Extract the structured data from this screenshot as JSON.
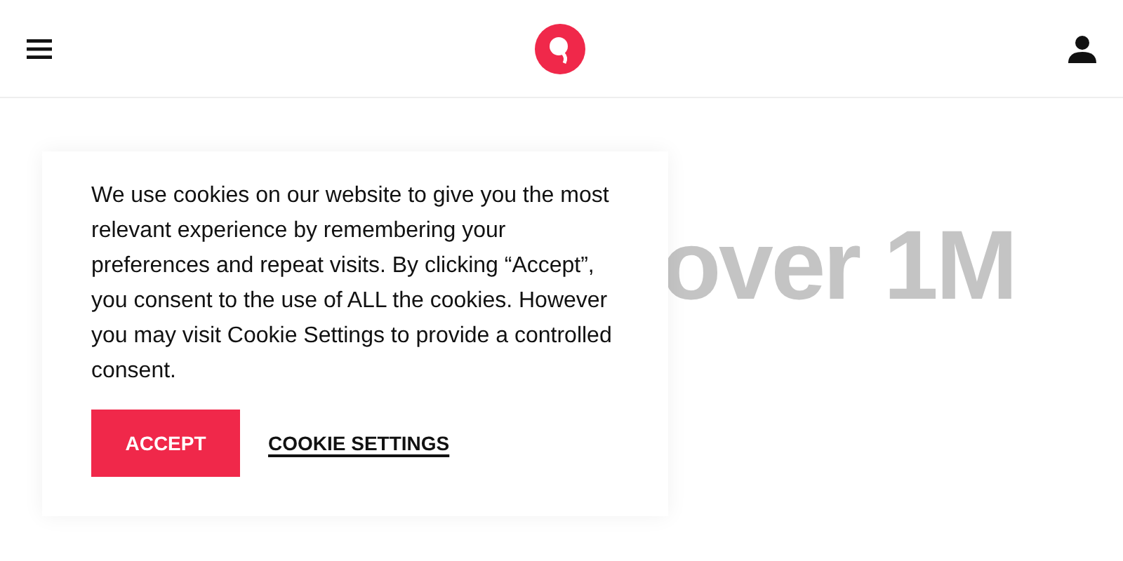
{
  "hero": {
    "heading": "over 1M"
  },
  "cookie_banner": {
    "message": "We use cookies on our website to give you the most relevant experience by remembering your preferences and repeat visits. By clicking “Accept”, you consent to the use of ALL the cookies. However you may visit Cookie Settings to provide a controlled consent.",
    "accept_button": "ACCEPT",
    "settings_link": "COOKIE SETTINGS"
  }
}
